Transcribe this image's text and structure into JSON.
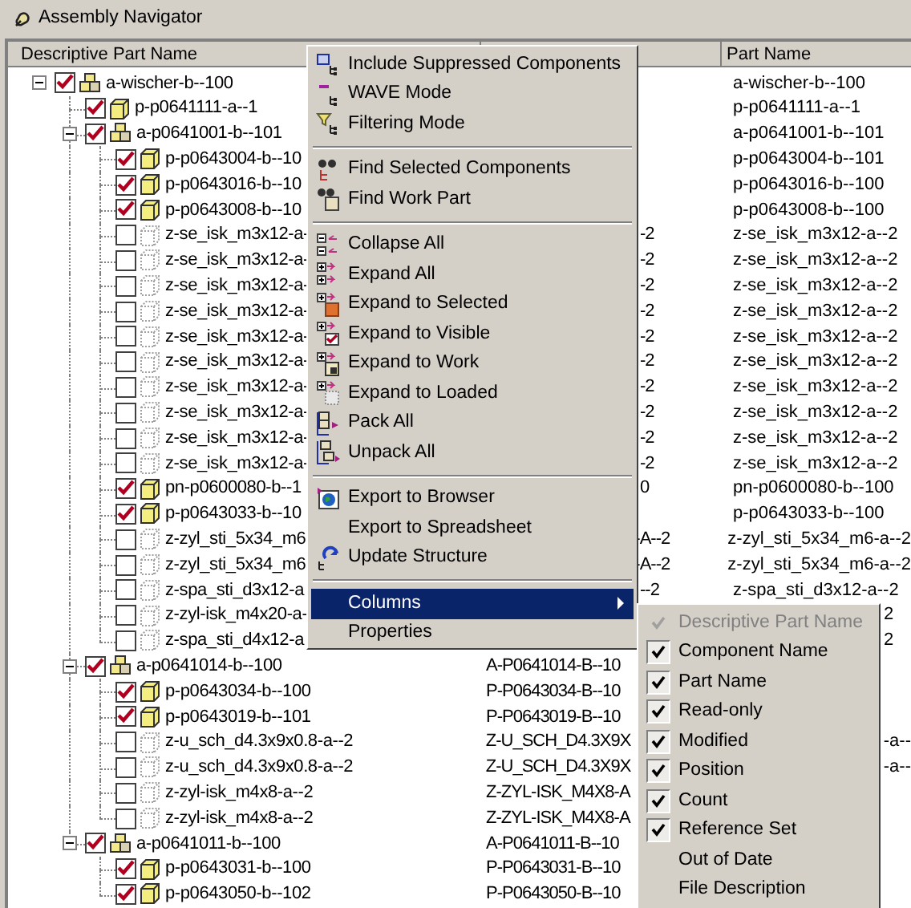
{
  "window": {
    "title": "Assembly Navigator"
  },
  "headers": {
    "tree": "Descriptive Part Name",
    "part_name": "Part Name"
  },
  "tree": [
    {
      "name": "a-wischer-b--100",
      "kind": "assembly",
      "checked": true,
      "expanded": true,
      "part_name": "a-wischer-b--100",
      "children": [
        {
          "name": "p-p0641111-a--1",
          "kind": "part",
          "checked": true,
          "part_name": "p-p0641111-a--1"
        },
        {
          "name": "a-p0641001-b--101",
          "kind": "assembly",
          "checked": true,
          "expanded": true,
          "part_name": "a-p0641001-b--101",
          "children": [
            {
              "name": "p-p0643004-b--10",
              "kind": "part",
              "checked": true,
              "part_name": "p-p0643004-b--101"
            },
            {
              "name": "p-p0643016-b--10",
              "kind": "part",
              "checked": true,
              "part_name": "p-p0643016-b--100"
            },
            {
              "name": "p-p0643008-b--10",
              "kind": "part",
              "checked": true,
              "part_name": "p-p0643008-b--100"
            },
            {
              "name": "z-se_isk_m3x12-a-",
              "kind": "unloaded",
              "checked": false,
              "component_name": "-2",
              "part_name": "z-se_isk_m3x12-a--2"
            },
            {
              "name": "z-se_isk_m3x12-a-",
              "kind": "unloaded",
              "checked": false,
              "component_name": "-2",
              "part_name": "z-se_isk_m3x12-a--2"
            },
            {
              "name": "z-se_isk_m3x12-a-",
              "kind": "unloaded",
              "checked": false,
              "component_name": "-2",
              "part_name": "z-se_isk_m3x12-a--2"
            },
            {
              "name": "z-se_isk_m3x12-a-",
              "kind": "unloaded",
              "checked": false,
              "component_name": "-2",
              "part_name": "z-se_isk_m3x12-a--2"
            },
            {
              "name": "z-se_isk_m3x12-a-",
              "kind": "unloaded",
              "checked": false,
              "component_name": "-2",
              "part_name": "z-se_isk_m3x12-a--2"
            },
            {
              "name": "z-se_isk_m3x12-a-",
              "kind": "unloaded",
              "checked": false,
              "component_name": "-2",
              "part_name": "z-se_isk_m3x12-a--2"
            },
            {
              "name": "z-se_isk_m3x12-a-",
              "kind": "unloaded",
              "checked": false,
              "component_name": "-2",
              "part_name": "z-se_isk_m3x12-a--2"
            },
            {
              "name": "z-se_isk_m3x12-a-",
              "kind": "unloaded",
              "checked": false,
              "component_name": "-2",
              "part_name": "z-se_isk_m3x12-a--2"
            },
            {
              "name": "z-se_isk_m3x12-a-",
              "kind": "unloaded",
              "checked": false,
              "component_name": "-2",
              "part_name": "z-se_isk_m3x12-a--2"
            },
            {
              "name": "z-se_isk_m3x12-a-",
              "kind": "unloaded",
              "checked": false,
              "component_name": "-2",
              "part_name": "z-se_isk_m3x12-a--2"
            },
            {
              "name": "pn-p0600080-b--1",
              "kind": "part",
              "checked": true,
              "component_name": "0",
              "part_name": "pn-p0600080-b--100"
            },
            {
              "name": "p-p0643033-b--10",
              "kind": "part",
              "checked": true,
              "part_name": "p-p0643033-b--100"
            },
            {
              "name": "z-zyl_sti_5x34_m6",
              "kind": "unloaded",
              "checked": false,
              "component_name": "-A--2",
              "part_name": "z-zyl_sti_5x34_m6-a--2"
            },
            {
              "name": "z-zyl_sti_5x34_m6",
              "kind": "unloaded",
              "checked": false,
              "component_name": "-A--2",
              "part_name": "z-zyl_sti_5x34_m6-a--2"
            },
            {
              "name": "z-spa_sti_d3x12-a",
              "kind": "unloaded",
              "checked": false,
              "component_name": "--2",
              "part_name": "z-spa_sti_d3x12-a--2"
            },
            {
              "name": "z-zyl-isk_m4x20-a-",
              "kind": "unloaded",
              "checked": false,
              "part_name": "2"
            },
            {
              "name": "z-spa_sti_d4x12-a",
              "kind": "unloaded",
              "checked": false,
              "part_name": "2"
            }
          ]
        },
        {
          "name": "a-p0641014-b--100",
          "kind": "assembly",
          "checked": true,
          "expanded": true,
          "component_name": "A-P0641014-B--10",
          "children": [
            {
              "name": "p-p0643034-b--100",
              "kind": "part",
              "checked": true,
              "component_name": "P-P0643034-B--10"
            },
            {
              "name": "p-p0643019-b--101",
              "kind": "part",
              "checked": true,
              "component_name": "P-P0643019-B--10"
            },
            {
              "name": "z-u_sch_d4.3x9x0.8-a--2",
              "kind": "unloaded",
              "checked": false,
              "component_name": "Z-U_SCH_D4.3X9X",
              "part_name": "-a--"
            },
            {
              "name": "z-u_sch_d4.3x9x0.8-a--2",
              "kind": "unloaded",
              "checked": false,
              "component_name": "Z-U_SCH_D4.3X9X",
              "part_name": "-a--"
            },
            {
              "name": "z-zyl-isk_m4x8-a--2",
              "kind": "unloaded",
              "checked": false,
              "component_name": "Z-ZYL-ISK_M4X8-A"
            },
            {
              "name": "z-zyl-isk_m4x8-a--2",
              "kind": "unloaded",
              "checked": false,
              "component_name": "Z-ZYL-ISK_M4X8-A"
            }
          ]
        },
        {
          "name": "a-p0641011-b--100",
          "kind": "assembly",
          "checked": true,
          "expanded": true,
          "component_name": "A-P0641011-B--10",
          "children": [
            {
              "name": "p-p0643031-b--100",
              "kind": "part",
              "checked": true,
              "component_name": "P-P0643031-B--10"
            },
            {
              "name": "p-p0643050-b--102",
              "kind": "part",
              "checked": true,
              "component_name": "P-P0643050-B--10"
            }
          ]
        }
      ]
    }
  ],
  "context_menu": {
    "groups": [
      [
        {
          "label": "Include Suppressed Components",
          "selected": false
        },
        {
          "label": "WAVE Mode",
          "selected": false
        },
        {
          "label": "Filtering Mode",
          "selected": false
        }
      ],
      [
        {
          "label": "Find Selected Components",
          "selected": false
        },
        {
          "label": "Find Work Part",
          "selected": false
        }
      ],
      [
        {
          "label": "Collapse All",
          "selected": false
        },
        {
          "label": "Expand All",
          "selected": false
        },
        {
          "label": "Expand to Selected",
          "selected": false
        },
        {
          "label": "Expand to Visible",
          "selected": false
        },
        {
          "label": "Expand to Work",
          "selected": false
        },
        {
          "label": "Expand to Loaded",
          "selected": false
        },
        {
          "label": "Pack All",
          "selected": false
        },
        {
          "label": "Unpack All",
          "selected": false
        }
      ],
      [
        {
          "label": "Export to Browser",
          "selected": false
        },
        {
          "label": "Export to Spreadsheet",
          "selected": false
        },
        {
          "label": "Update Structure",
          "selected": false
        }
      ],
      [
        {
          "label": "Columns",
          "selected": true,
          "has_submenu": true
        },
        {
          "label": "Properties",
          "selected": false
        }
      ]
    ]
  },
  "columns_menu": {
    "items": [
      {
        "label": "Descriptive Part Name",
        "checked": true,
        "disabled": true
      },
      {
        "label": "Component Name",
        "checked": true,
        "disabled": false
      },
      {
        "label": "Part Name",
        "checked": true,
        "disabled": false
      },
      {
        "label": "Read-only",
        "checked": true,
        "disabled": false
      },
      {
        "label": "Modified",
        "checked": true,
        "disabled": false
      },
      {
        "label": "Position",
        "checked": true,
        "disabled": false
      },
      {
        "label": "Count",
        "checked": true,
        "disabled": false
      },
      {
        "label": "Reference Set",
        "checked": true,
        "disabled": false
      },
      {
        "label": "Out of Date",
        "checked": false,
        "disabled": false
      },
      {
        "label": "File Description",
        "checked": false,
        "disabled": false
      }
    ]
  }
}
